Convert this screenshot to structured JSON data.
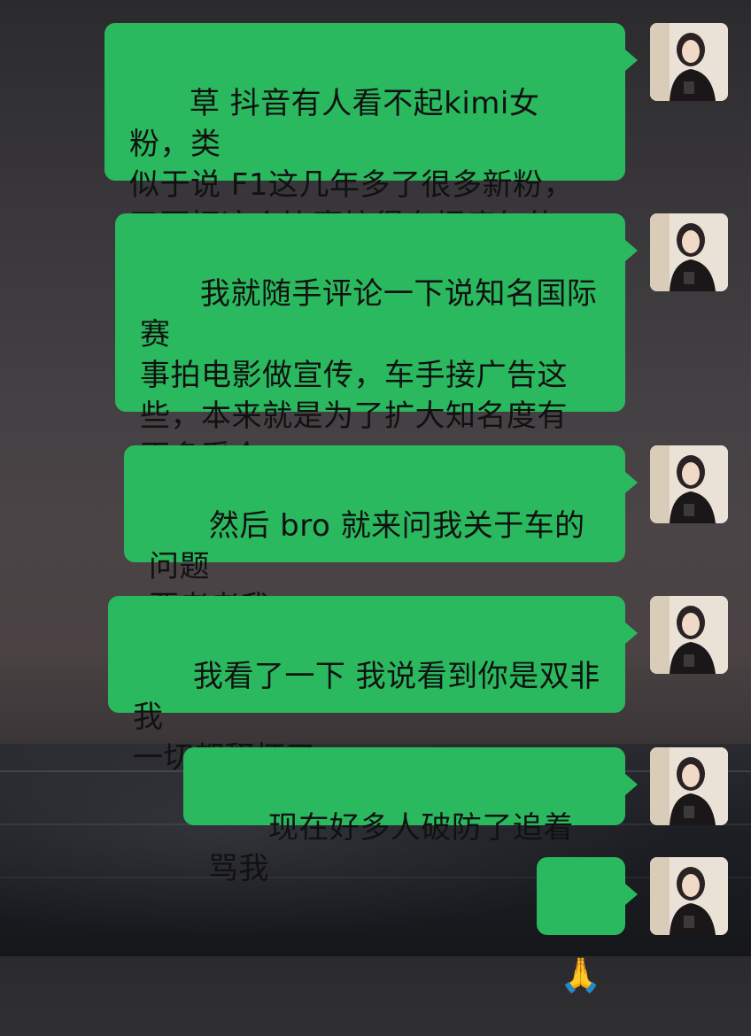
{
  "messages": [
    {
      "id": 1,
      "text": "草 抖音有人看不起kimi女粉，类\n似于说 F1这几年多了很多新粉，\n又要把这个比赛搞得乌烟瘴气的"
    },
    {
      "id": 2,
      "text": "我就随手评论一下说知名国际赛\n事拍电影做宣传，车手接广告这\n些，本来就是为了扩大知名度有\n更多受众"
    },
    {
      "id": 3,
      "text": "然后 bro 就来问我关于车的问题\n要考考我"
    },
    {
      "id": 4,
      "text": "我看了一下 我说看到你是双非我\n一切都释怀了"
    },
    {
      "id": 5,
      "text": "现在好多人破防了追着骂我"
    },
    {
      "id": 6,
      "text": "🙏"
    }
  ],
  "colors": {
    "bubble_bg": "#2ab95f",
    "text": "#111111"
  }
}
